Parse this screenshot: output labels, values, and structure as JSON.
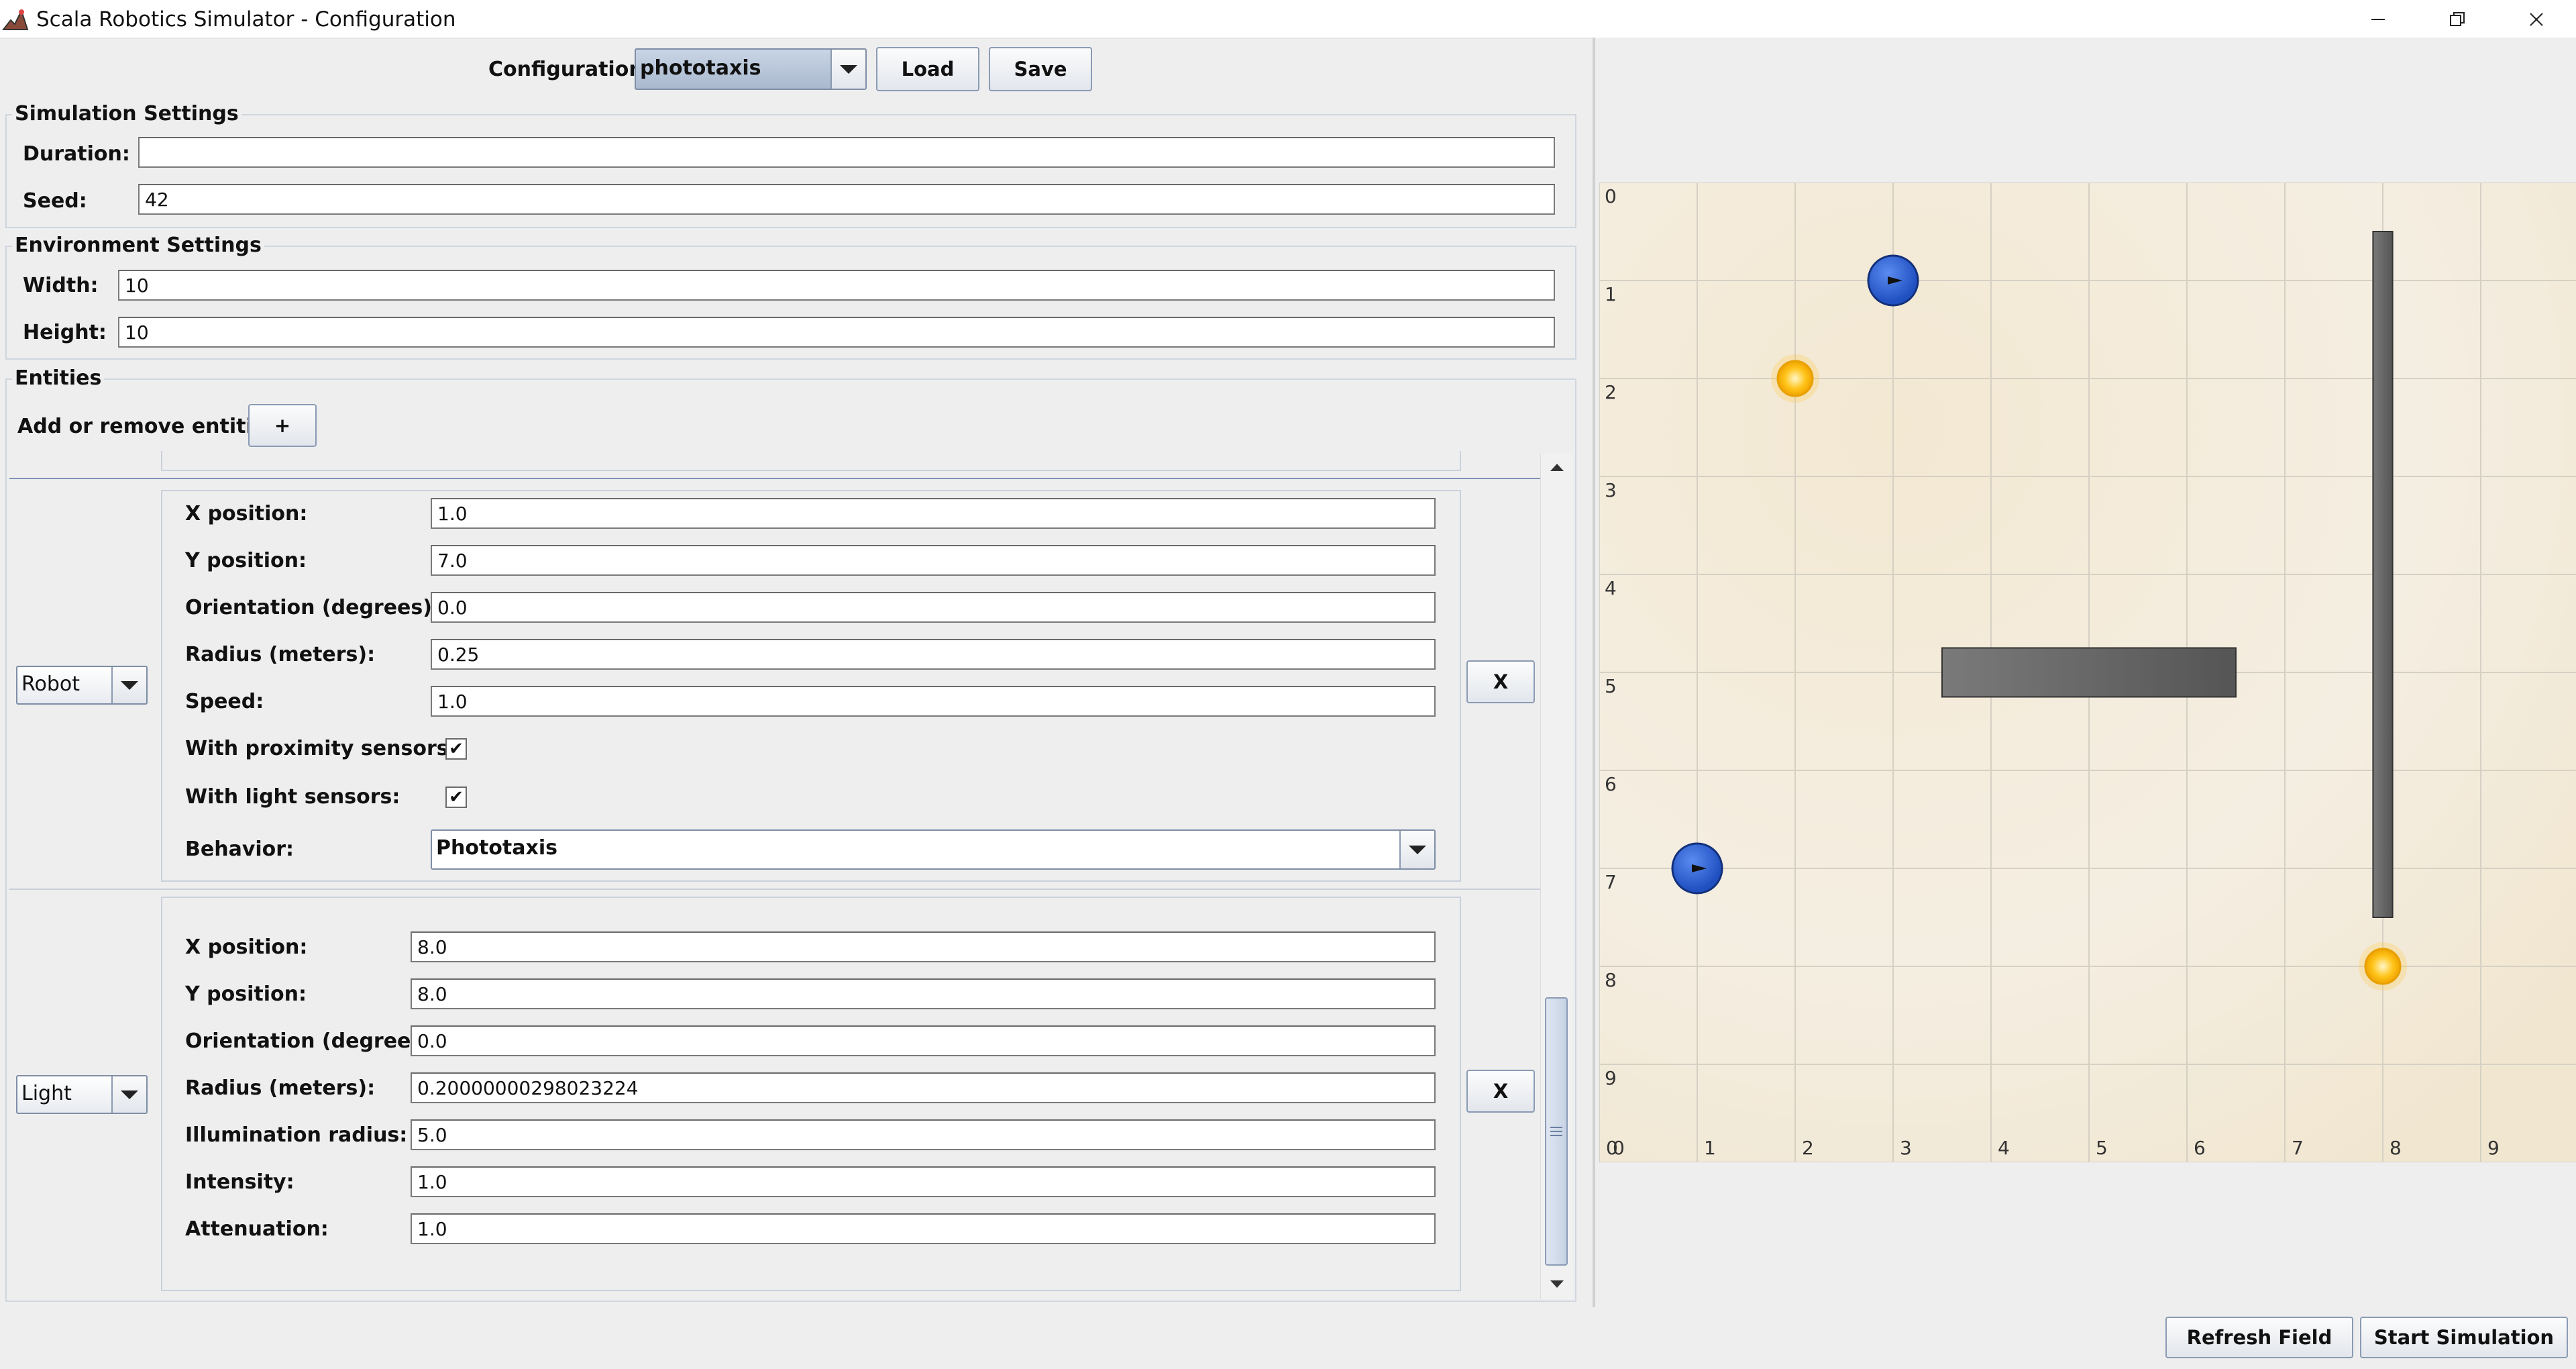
{
  "window": {
    "title": "Scala Robotics Simulator - Configuration",
    "icons": [
      "app-icon",
      "minimize-icon",
      "restore-icon",
      "close-icon"
    ]
  },
  "toolbar": {
    "configuration_label": "Configuration:",
    "configuration_value": "phototaxis",
    "load_label": "Load",
    "save_label": "Save"
  },
  "simulation": {
    "title": "Simulation Settings",
    "duration_label": "Duration:",
    "duration_value": "",
    "seed_label": "Seed:",
    "seed_value": "42"
  },
  "environment": {
    "title": "Environment Settings",
    "width_label": "Width:",
    "width_value": "10",
    "height_label": "Height:",
    "height_value": "10"
  },
  "entities": {
    "title": "Entities",
    "add_remove_label": "Add or remove entities:",
    "add_label": "+",
    "remove_label": "X",
    "robot": {
      "type": "Robot",
      "x_label": "X position:",
      "x_value": "1.0",
      "y_label": "Y position:",
      "y_value": "7.0",
      "orientation_label": "Orientation (degrees):",
      "orientation_value": "0.0",
      "radius_label": "Radius (meters):",
      "radius_value": "0.25",
      "speed_label": "Speed:",
      "speed_value": "1.0",
      "proximity_label": "With proximity sensors:",
      "proximity_checked": true,
      "light_sensors_label": "With light sensors:",
      "light_sensors_checked": true,
      "checkmark": "✔",
      "behavior_label": "Behavior:",
      "behavior_value": "Phototaxis"
    },
    "light": {
      "type": "Light",
      "x_label": "X position:",
      "x_value": "8.0",
      "y_label": "Y position:",
      "y_value": "8.0",
      "orientation_label": "Orientation (degrees):",
      "orientation_value": "0.0",
      "radius_label": "Radius (meters):",
      "radius_value": "0.20000000298023224",
      "illumination_label": "Illumination radius:",
      "illumination_value": "5.0",
      "intensity_label": "Intensity:",
      "intensity_value": "1.0",
      "attenuation_label": "Attenuation:",
      "attenuation_value": "1.0"
    }
  },
  "field": {
    "grid_size": 10,
    "y_ticks": [
      "0",
      "1",
      "2",
      "3",
      "4",
      "5",
      "6",
      "7",
      "8",
      "9"
    ],
    "x_ticks": [
      "0",
      "1",
      "2",
      "3",
      "4",
      "5",
      "6",
      "7",
      "8",
      "9"
    ],
    "origin_label": "0",
    "robots": [
      {
        "x": 3.0,
        "y": 1.0,
        "orientation": 0
      },
      {
        "x": 1.0,
        "y": 7.0,
        "orientation": 0
      }
    ],
    "lights": [
      {
        "x": 2.0,
        "y": 2.0
      },
      {
        "x": 8.0,
        "y": 8.0
      }
    ],
    "obstacles": [
      {
        "x_min": 3.5,
        "x_max": 6.5,
        "y_min": 4.75,
        "y_max": 5.25
      },
      {
        "x_min": 7.9,
        "x_max": 8.1,
        "y_min": 0.5,
        "y_max": 7.5
      }
    ],
    "colors": {
      "robot": "#2f64d6",
      "light": "#f5b400",
      "obstacle": "#606060",
      "background": "#f3ead7"
    }
  },
  "footer": {
    "refresh_label": "Refresh Field",
    "start_label": "Start Simulation"
  }
}
